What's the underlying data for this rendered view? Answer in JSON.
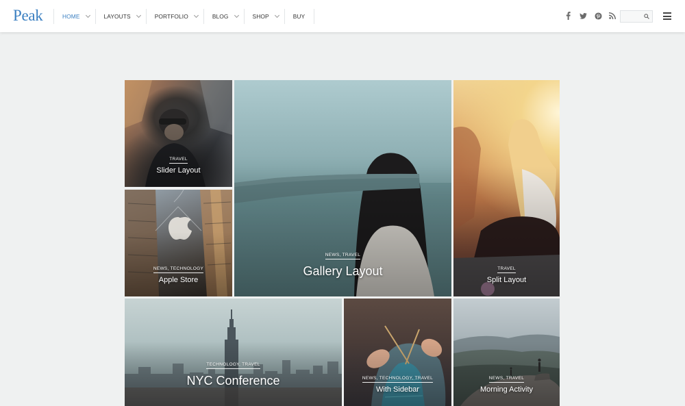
{
  "header": {
    "logo": "Peak",
    "nav": [
      {
        "label": "HOME",
        "active": true,
        "dropdown": true
      },
      {
        "label": "LAYOUTS",
        "active": false,
        "dropdown": true
      },
      {
        "label": "PORTFOLIO",
        "active": false,
        "dropdown": true
      },
      {
        "label": "BLOG",
        "active": false,
        "dropdown": true
      },
      {
        "label": "SHOP",
        "active": false,
        "dropdown": true
      },
      {
        "label": "BUY",
        "active": false,
        "dropdown": false
      }
    ],
    "social": [
      "facebook-icon",
      "twitter-icon",
      "pinterest-icon",
      "rss-icon"
    ],
    "search": {
      "value": "",
      "placeholder": ""
    },
    "accent_color": "#3a7fc1"
  },
  "grid": {
    "tiles": [
      {
        "id": "slider-layout",
        "cats": "TRAVEL",
        "title": "Slider Layout"
      },
      {
        "id": "apple-store",
        "cats": "NEWS, TECHNOLOGY",
        "title": "Apple Store"
      },
      {
        "id": "gallery-layout",
        "cats": "NEWS, TRAVEL",
        "title": "Gallery Layout"
      },
      {
        "id": "split-layout",
        "cats": "TRAVEL",
        "title": "Split Layout"
      },
      {
        "id": "nyc-conference",
        "cats": "TECHNOLOGY, TRAVEL",
        "title": "NYC Conference"
      },
      {
        "id": "with-sidebar",
        "cats": "NEWS, TECHNOLOGY, TRAVEL",
        "title": "With Sidebar"
      },
      {
        "id": "morning-activity",
        "cats": "NEWS, TRAVEL",
        "title": "Morning Activity"
      }
    ]
  }
}
